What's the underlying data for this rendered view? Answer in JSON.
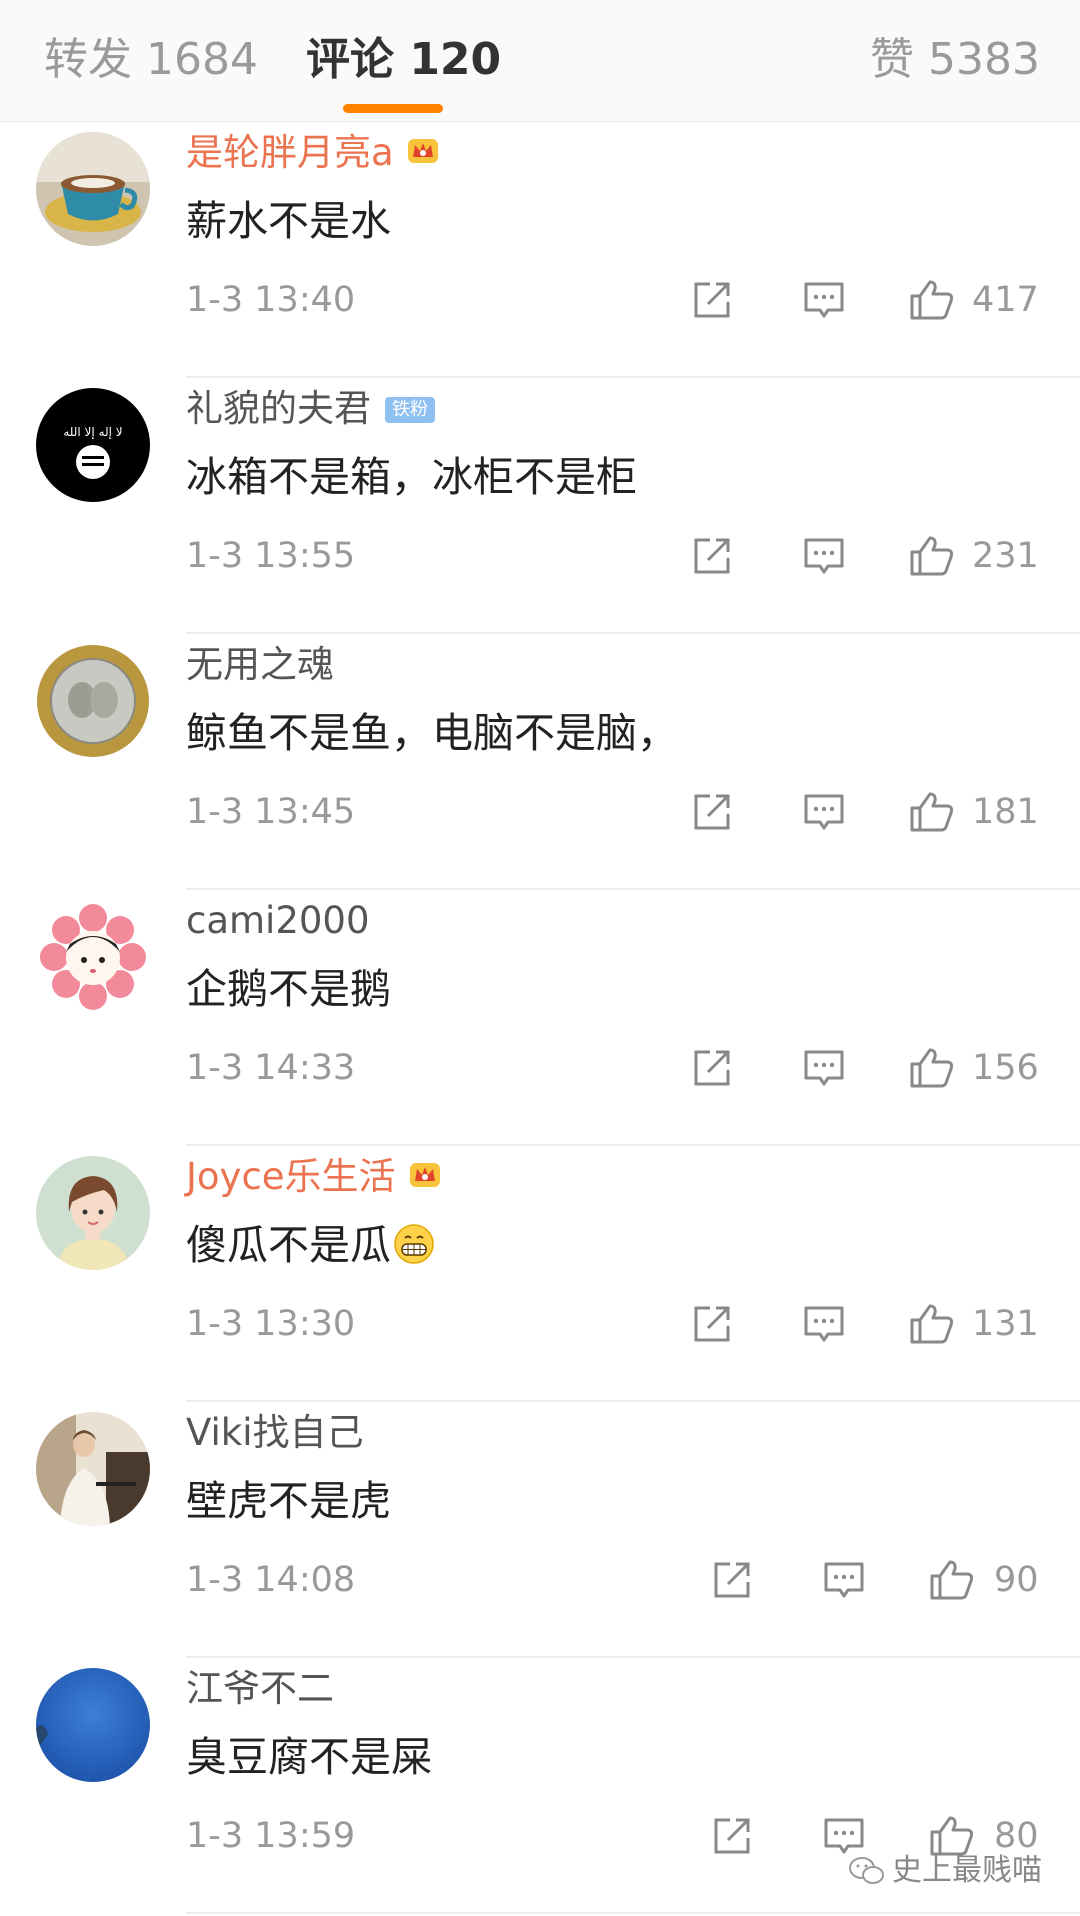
{
  "tabs": {
    "forward": "转发 1684",
    "comments": "评论 120",
    "likes": "赞 5383"
  },
  "comments": [
    {
      "user": "是轮胖月亮a",
      "vip": true,
      "text": "薪水不是水",
      "time": "1-3 13:40",
      "likes": "417"
    },
    {
      "user": "礼貌的夫君",
      "badge": "铁粉",
      "text": "冰箱不是箱，冰柜不是柜",
      "time": "1-3 13:55",
      "likes": "231"
    },
    {
      "user": "无用之魂",
      "text": "鲸鱼不是鱼，电脑不是脑，",
      "time": "1-3 13:45",
      "likes": "181"
    },
    {
      "user": "cami2000",
      "text": "企鹅不是鹅",
      "time": "1-3 14:33",
      "likes": "156"
    },
    {
      "user": "Joyce乐生活",
      "vip": true,
      "text": "傻瓜不是瓜",
      "emoji": "grin-emoji",
      "time": "1-3 13:30",
      "likes": "131"
    },
    {
      "user": "Viki找自己",
      "text": "壁虎不是虎",
      "time": "1-3 14:08",
      "likes": "90"
    },
    {
      "user": "江爷不二",
      "text": "臭豆腐不是屎",
      "time": "1-3 13:59",
      "likes": "80"
    }
  ],
  "avatar_text": {
    "black_flag": "لا إله إلا الله"
  },
  "watermark": "史上最贱喵",
  "colors": {
    "accent": "#ff8200",
    "vip_name": "#eb7350",
    "badge": "#8ec0f2"
  },
  "icons": [
    "share-icon",
    "reply-icon",
    "thumb-up-icon",
    "vip-crown-icon",
    "wechat-icon"
  ]
}
